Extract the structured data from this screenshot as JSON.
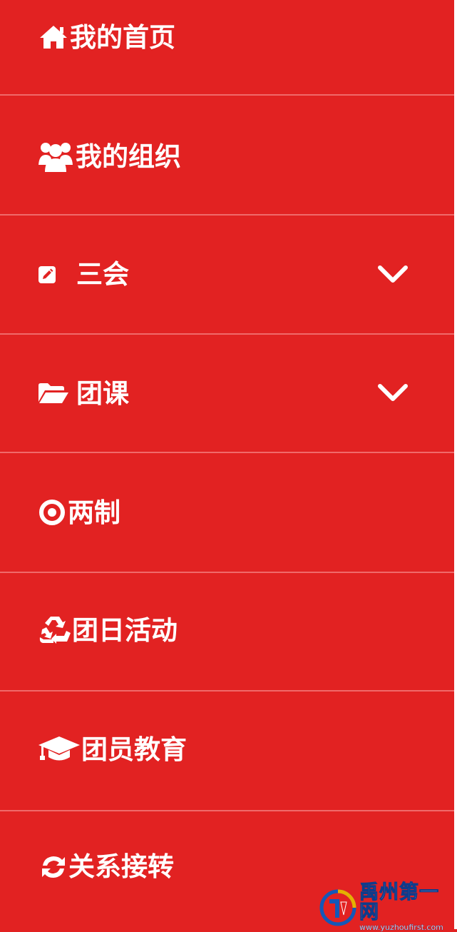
{
  "theme": {
    "background": "#e22222",
    "text": "#ffffff",
    "divider": "#f06a6a"
  },
  "menu": {
    "items": [
      {
        "label": "我的首页",
        "icon": "home-icon",
        "expandable": false
      },
      {
        "label": "我的组织",
        "icon": "users-icon",
        "expandable": false
      },
      {
        "label": "三会",
        "icon": "edit-icon",
        "expandable": true
      },
      {
        "label": "团课",
        "icon": "folder-open-icon",
        "expandable": true
      },
      {
        "label": "两制",
        "icon": "target-icon",
        "expandable": false
      },
      {
        "label": "团日活动",
        "icon": "recycle-icon",
        "expandable": false
      },
      {
        "label": "团员教育",
        "icon": "graduation-cap-icon",
        "expandable": false
      },
      {
        "label": "关系接转",
        "icon": "refresh-icon",
        "expandable": false
      }
    ]
  },
  "watermark": {
    "title": "禹州第一网",
    "url": "www.yuzhoufirst.com"
  }
}
